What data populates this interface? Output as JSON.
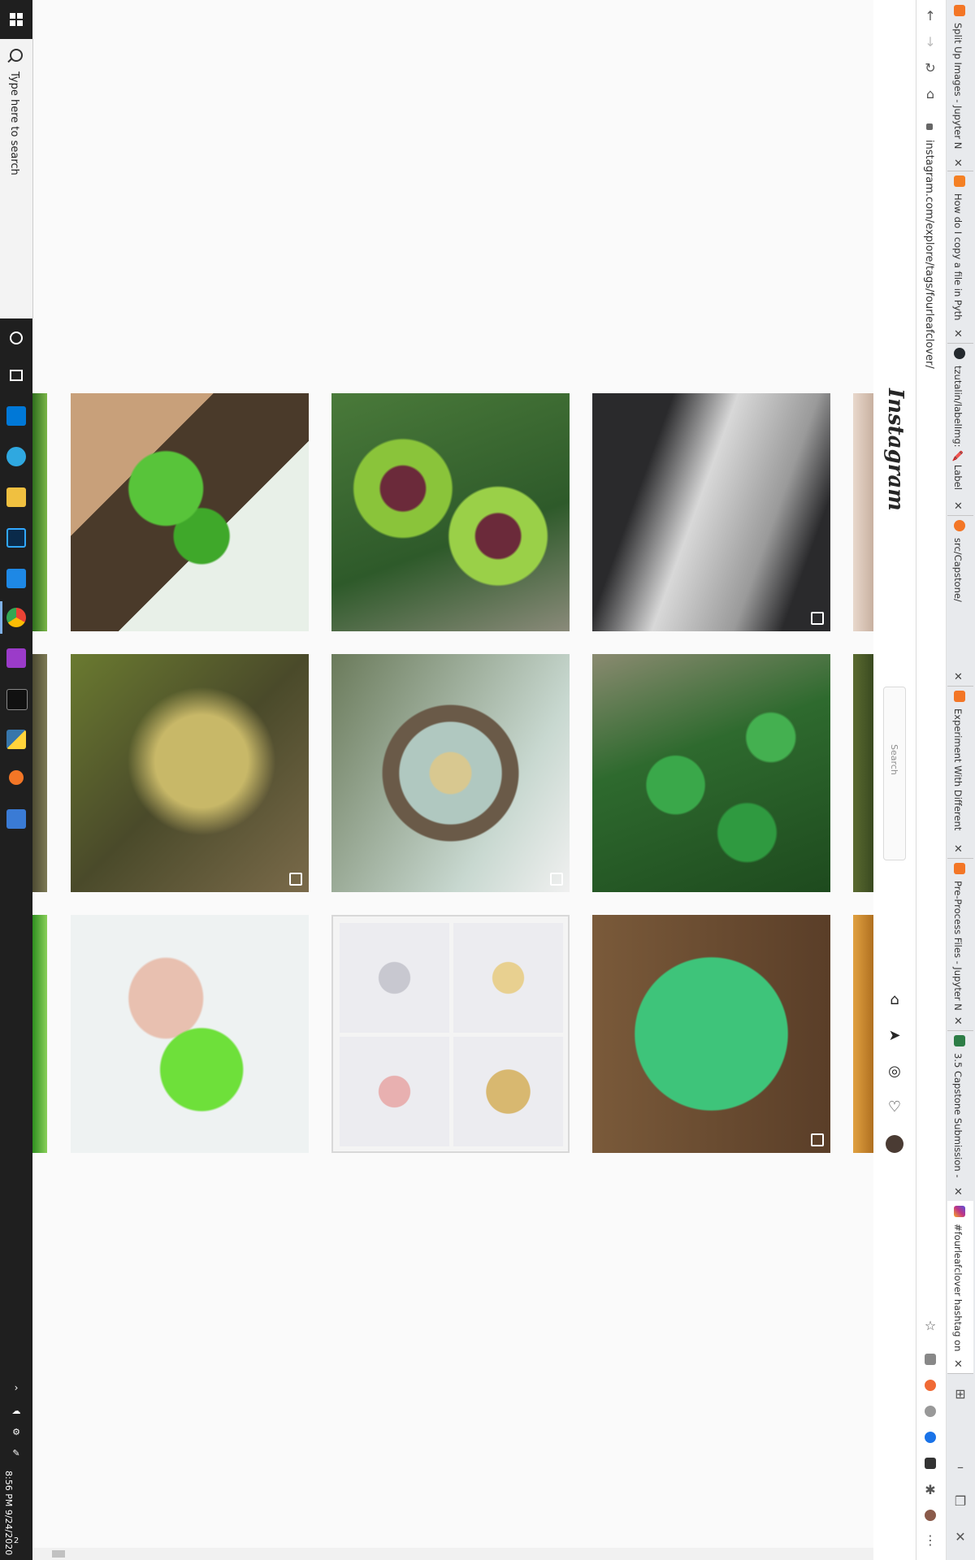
{
  "taskbar": {
    "search_placeholder": "Type here to search",
    "time": "8:56 PM",
    "date": "9/24/2020",
    "notification_count": "2",
    "apps": [
      "start-icon",
      "cortana-icon",
      "task-view-icon",
      "store-icon",
      "edge-icon",
      "file-explorer-icon",
      "photoshop-icon",
      "app-icon",
      "chrome-icon",
      "onenote-icon",
      "terminal-icon",
      "python-icon",
      "jupyter-icon",
      "calculator-icon"
    ]
  },
  "browser": {
    "url": "instagram.com/explore/tags/fourleafclover/",
    "tabs": [
      {
        "label": "Split Up Images - Jupyter N",
        "favicon_color": "#f37626"
      },
      {
        "label": "How do I copy a file in Pyth",
        "favicon_color": "#f48024"
      },
      {
        "label": "tzutalin/labelImg: 🖍️ Label",
        "favicon_color": "#24292e"
      },
      {
        "label": "src/Capstone/",
        "favicon_color": "#f37626"
      },
      {
        "label": "Experiment With Different",
        "favicon_color": "#f37626"
      },
      {
        "label": "Pre-Process Files - Jupyter N",
        "favicon_color": "#f37626"
      },
      {
        "label": "3.5 Capstone Submission -",
        "favicon_color": "#2d7d46"
      },
      {
        "label": "#fourleafclover hashtag on",
        "favicon_color": "#c13584"
      }
    ]
  },
  "instagram": {
    "logo": "Instagram",
    "search_placeholder": "Search"
  },
  "grid": {
    "rows": [
      [
        "clover-in-hand",
        "four-leaf-clover-plant",
        "clover-tattoo-arm"
      ],
      [
        "clover-resin-pendant",
        "pressed-flower-frame",
        "clover-patch-ground"
      ],
      [
        "clover-nail-art",
        "clover-charms-set",
        "green-tshirt"
      ]
    ]
  }
}
